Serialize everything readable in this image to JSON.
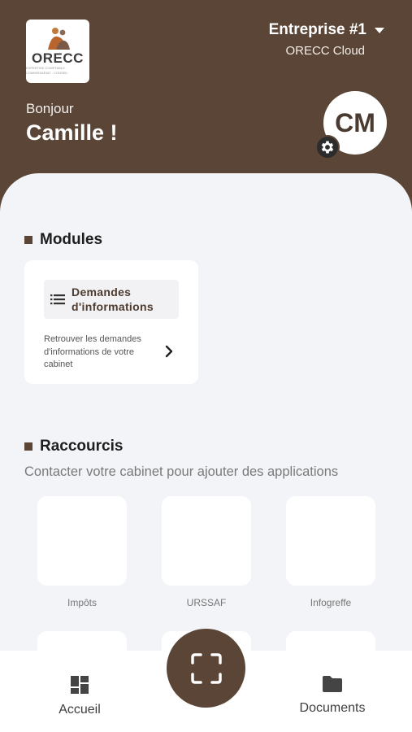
{
  "header": {
    "logo": {
      "text": "ORECC",
      "sub": "EXPERTISE COMPTABLE · COMMISSARIAT · CONSEIL"
    },
    "company": {
      "name": "Entreprise #1",
      "subtitle": "ORECC Cloud"
    },
    "greeting": {
      "hello": "Bonjour",
      "name": "Camille !"
    },
    "avatar_initials": "CM"
  },
  "modules": {
    "title": "Modules",
    "card": {
      "label": "Demandes d'informations",
      "description": "Retrouver les demandes d'informations de votre cabinet"
    }
  },
  "shortcuts": {
    "title": "Raccourcis",
    "note": "Contacter votre cabinet pour ajouter des applications",
    "tiles": [
      "Impôts",
      "URSSAF",
      "Infogreffe"
    ]
  },
  "nav": {
    "home": "Accueil",
    "documents": "Documents"
  },
  "colors": {
    "brand": "#5a4537",
    "background": "#f2f4f8"
  }
}
